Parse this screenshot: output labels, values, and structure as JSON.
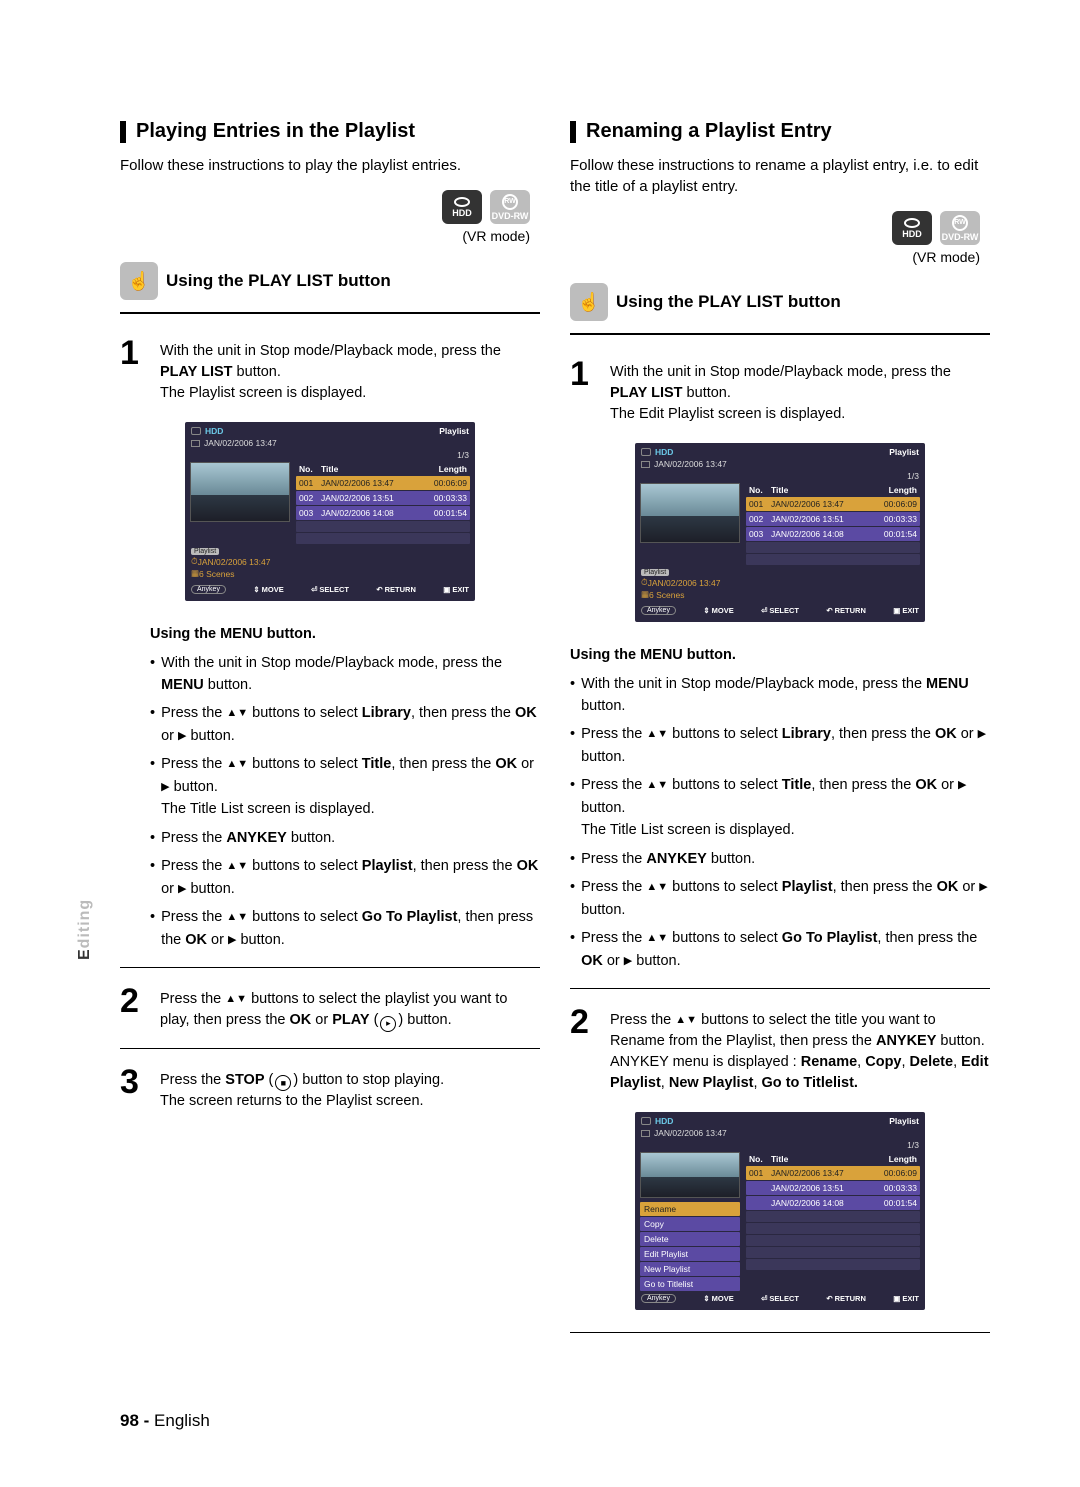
{
  "sidetab": {
    "word": "Editing",
    "dark": "E",
    "light": "diting"
  },
  "footer": {
    "num": "98 -",
    "lang": "English"
  },
  "left": {
    "heading": "Playing Entries in the Playlist",
    "intro": "Follow these instructions to play the playlist entries.",
    "badge_hdd": "HDD",
    "badge_dvdrw": "DVD-RW",
    "mode_note": "(VR mode)",
    "sub": "Using the PLAY LIST button",
    "step1": {
      "num": "1",
      "line1a": "With the unit in Stop mode/Playback mode, press the ",
      "line1b": "PLAY LIST",
      "line1c": " button.",
      "line2": "The Playlist screen is displayed."
    },
    "osd": {
      "hdd": "HDD",
      "title_right": "Playlist",
      "date": "JAN/02/2006 13:47",
      "frac": "1/3",
      "thead_no": "No.",
      "thead_title": "Title",
      "thead_len": "Length",
      "rows": [
        {
          "no": "001",
          "title": "JAN/02/2006 13:47",
          "len": "00:06:09"
        },
        {
          "no": "002",
          "title": "JAN/02/2006 13:51",
          "len": "00:03:33"
        },
        {
          "no": "003",
          "title": "JAN/02/2006 14:08",
          "len": "00:01:54"
        }
      ],
      "info_label": "Playlist",
      "info_date": "JAN/02/2006 13:47",
      "info_scenes": "6 Scenes",
      "nav_anykey": "Anykey",
      "nav_move": "MOVE",
      "nav_select": "SELECT",
      "nav_return": "RETURN",
      "nav_exit": "EXIT"
    },
    "menu_heading": "Using the MENU button.",
    "menu_items": {
      "i1a": "With the unit in Stop mode/Playback mode, press the ",
      "i1b": "MENU",
      "i1c": " button.",
      "i2a": "Press the ",
      "i2b": " buttons to select ",
      "i2c": "Library",
      "i2d": ", then press the ",
      "i2e": "OK",
      "i2f": " or ",
      "i2g": " button.",
      "i3a": "Press the ",
      "i3b": " buttons to select ",
      "i3c": "Title",
      "i3d": ", then press the ",
      "i3e": "OK",
      "i3f": " or ",
      "i3g": " button.",
      "i3h": "The Title List screen is displayed.",
      "i4a": "Press the ",
      "i4b": "ANYKEY",
      "i4c": " button.",
      "i5a": "Press the ",
      "i5b": " buttons to select ",
      "i5c": "Playlist",
      "i5d": ", then press the ",
      "i5e": "OK",
      "i5f": " or ",
      "i5g": " button.",
      "i6a": "Press the ",
      "i6b": " buttons to select ",
      "i6c": "Go To Playlist",
      "i6d": ", then press the ",
      "i6e": "OK",
      "i6f": " or ",
      "i6g": " button."
    },
    "step2": {
      "num": "2",
      "t1": "Press the ",
      "t2": " buttons to select the playlist you want to play, then press the ",
      "t3": "OK",
      "t4": " or ",
      "t5": "PLAY",
      "t6": " (",
      "t7": ") button."
    },
    "step3": {
      "num": "3",
      "t1": "Press the ",
      "t2": "STOP",
      "t3": " (",
      "t4": ")  button to stop playing.",
      "t5": "The screen returns to the Playlist screen."
    }
  },
  "right": {
    "heading": "Renaming a Playlist Entry",
    "intro": "Follow these instructions to rename a playlist entry, i.e. to edit the title of a playlist entry.",
    "badge_hdd": "HDD",
    "badge_dvdrw": "DVD-RW",
    "mode_note": "(VR mode)",
    "sub": "Using the PLAY LIST button",
    "step1": {
      "num": "1",
      "line1a": "With the unit in Stop mode/Playback mode, press the ",
      "line1b": "PLAY LIST",
      "line1c": " button.",
      "line2": "The Edit Playlist screen is displayed."
    },
    "osd": {
      "hdd": "HDD",
      "title_right": "Playlist",
      "date": "JAN/02/2006 13:47",
      "frac": "1/3",
      "thead_no": "No.",
      "thead_title": "Title",
      "thead_len": "Length",
      "rows": [
        {
          "no": "001",
          "title": "JAN/02/2006 13:47",
          "len": "00:06:09"
        },
        {
          "no": "002",
          "title": "JAN/02/2006 13:51",
          "len": "00:03:33"
        },
        {
          "no": "003",
          "title": "JAN/02/2006 14:08",
          "len": "00:01:54"
        }
      ],
      "info_label": "Playlist",
      "info_date": "JAN/02/2006 13:47",
      "info_scenes": "6 Scenes",
      "nav_anykey": "Anykey",
      "nav_move": "MOVE",
      "nav_select": "SELECT",
      "nav_return": "RETURN",
      "nav_exit": "EXIT"
    },
    "menu_heading": "Using the MENU button.",
    "menu_items": {
      "i1a": "With the unit in Stop mode/Playback mode, press the ",
      "i1b": "MENU",
      "i1c": " button.",
      "i2a": "Press the ",
      "i2b": " buttons to select ",
      "i2c": "Library",
      "i2d": ", then press the ",
      "i2e": "OK",
      "i2f": " or ",
      "i2g": " button.",
      "i3a": "Press the ",
      "i3b": " buttons to select ",
      "i3c": "Title",
      "i3d": ", then press the ",
      "i3e": "OK",
      "i3f": " or ",
      "i3g": " button.",
      "i3h": "The Title List screen is displayed.",
      "i4a": "Press the ",
      "i4b": "ANYKEY",
      "i4c": " button.",
      "i5a": "Press the ",
      "i5b": " buttons to select ",
      "i5c": "Playlist",
      "i5d": ", then press the ",
      "i5e": "OK",
      "i5f": " or ",
      "i5g": " button.",
      "i6a": "Press the ",
      "i6b": " buttons to select ",
      "i6c": "Go To Playlist",
      "i6d": ", then press the ",
      "i6e": "OK",
      "i6f": " or ",
      "i6g": " button."
    },
    "step2": {
      "num": "2",
      "t1": "Press the ",
      "t2": " buttons to select the title you want to Rename from the Playlist, then press the ",
      "t3": "ANYKEY",
      "t4": " button.",
      "t5": "ANYKEY menu is displayed : ",
      "t6": "Rename",
      "t7": ", ",
      "t8": "Copy",
      "t9": ", ",
      "t10": "Delete",
      "t11": ", ",
      "t12": "Edit Playlist",
      "t13": ", ",
      "t14": "New Playlist",
      "t15": ", ",
      "t16": "Go to Titlelist."
    },
    "osd2": {
      "hdd": "HDD",
      "title_right": "Playlist",
      "date": "JAN/02/2006 13:47",
      "frac": "1/3",
      "thead_no": "No.",
      "thead_title": "Title",
      "thead_len": "Length",
      "row1": {
        "no": "001",
        "title": "JAN/02/2006 13:47",
        "len": "00:06:09"
      },
      "rowsright": [
        {
          "title": "JAN/02/2006 13:51",
          "len": "00:03:33"
        },
        {
          "title": "JAN/02/2006 14:08",
          "len": "00:01:54"
        }
      ],
      "menu": [
        "Rename",
        "Copy",
        "Delete",
        "Edit Playlist",
        "New Playlist",
        "Go to Titlelist"
      ],
      "nav_anykey": "Anykey",
      "nav_move": "MOVE",
      "nav_select": "SELECT",
      "nav_return": "RETURN",
      "nav_exit": "EXIT"
    }
  }
}
